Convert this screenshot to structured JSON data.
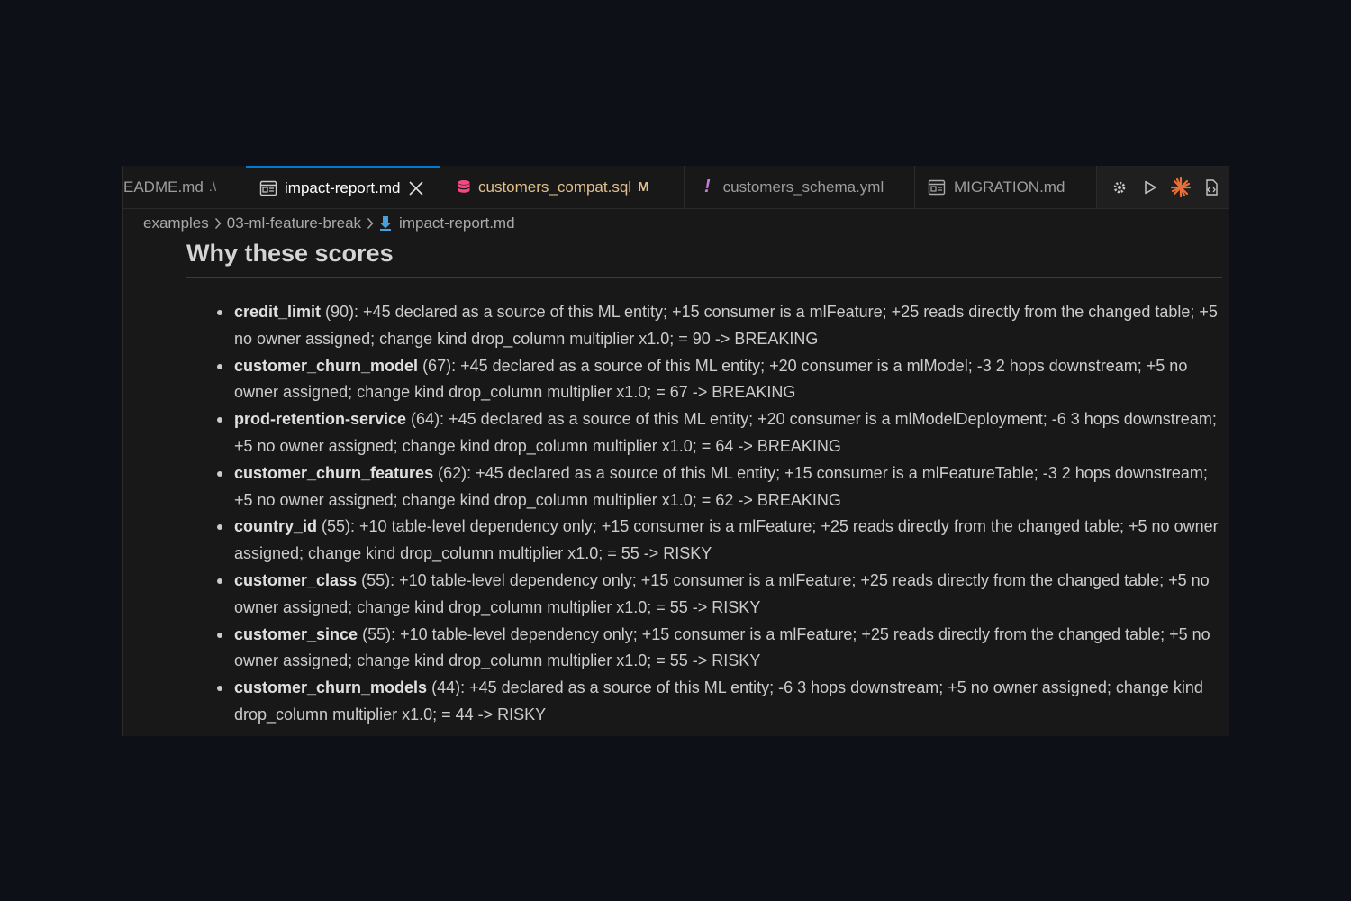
{
  "tabs": [
    {
      "label": "EADME.md",
      "desc": ".\\",
      "icon": "markdown-preview-icon"
    },
    {
      "label": "impact-report.md",
      "icon": "markdown-preview-icon",
      "active": true
    },
    {
      "label": "customers_compat.sql",
      "badge": "M",
      "icon": "database-icon"
    },
    {
      "label": "customers_schema.yml",
      "icon": "exclamation-icon"
    },
    {
      "label": "MIGRATION.md",
      "icon": "markdown-preview-icon"
    }
  ],
  "breadcrumb": [
    "examples",
    "03-ml-feature-break",
    "impact-report.md"
  ],
  "heading": "Why these scores",
  "items": [
    {
      "name": "credit_limit",
      "text": " (90): +45 declared as a source of this ML entity; +15 consumer is a mlFeature; +25 reads directly from the changed table; +5 no owner assigned; change kind drop_column multiplier x1.0; = 90 -> BREAKING"
    },
    {
      "name": "customer_churn_model",
      "text": " (67): +45 declared as a source of this ML entity; +20 consumer is a mlModel; -3 2 hops downstream; +5 no owner assigned; change kind drop_column multiplier x1.0; = 67 -> BREAKING"
    },
    {
      "name": "prod-retention-service",
      "text": " (64): +45 declared as a source of this ML entity; +20 consumer is a mlModelDeployment; -6 3 hops downstream; +5 no owner assigned; change kind drop_column multiplier x1.0; = 64 -> BREAKING"
    },
    {
      "name": "customer_churn_features",
      "text": " (62): +45 declared as a source of this ML entity; +15 consumer is a mlFeatureTable; -3 2 hops downstream; +5 no owner assigned; change kind drop_column multiplier x1.0; = 62 -> BREAKING"
    },
    {
      "name": "country_id",
      "text": " (55): +10 table-level dependency only; +15 consumer is a mlFeature; +25 reads directly from the changed table; +5 no owner assigned; change kind drop_column multiplier x1.0; = 55 -> RISKY"
    },
    {
      "name": "customer_class",
      "text": " (55): +10 table-level dependency only; +15 consumer is a mlFeature; +25 reads directly from the changed table; +5 no owner assigned; change kind drop_column multiplier x1.0; = 55 -> RISKY"
    },
    {
      "name": "customer_since",
      "text": " (55): +10 table-level dependency only; +15 consumer is a mlFeature; +25 reads directly from the changed table; +5 no owner assigned; change kind drop_column multiplier x1.0; = 55 -> RISKY"
    },
    {
      "name": "customer_churn_models",
      "text": " (44): +45 declared as a source of this ML entity; -6 3 hops downstream; +5 no owner assigned; change kind drop_column multiplier x1.0; = 44 -> RISKY"
    }
  ],
  "colors": {
    "accent": "#0078d4",
    "modified": "#e2c08d",
    "sql_icon": "#f14c81",
    "yml_icon": "#c678dd",
    "md_icon": "#4a9fd8",
    "sparkle": "#e8703a"
  },
  "action_icons": [
    "gear-icon",
    "run-icon",
    "sparkle-icon",
    "open-preview-icon"
  ]
}
